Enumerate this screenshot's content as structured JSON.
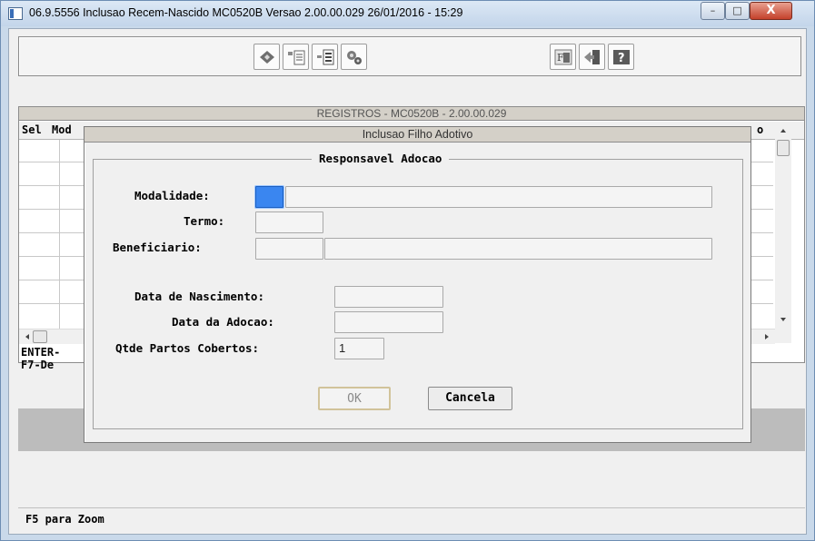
{
  "window": {
    "title": "06.9.5556 Inclusao Recem-Nascido MC0520B Versao 2.00.00.029 26/01/2016 - 15:29",
    "minimize": "–",
    "maximize": "□",
    "close": "X"
  },
  "toolbar": {
    "buttons": [
      "edit-icon",
      "list-icon",
      "insert-icon",
      "config-icon",
      "zoom-icon",
      "exit-icon",
      "help-icon"
    ]
  },
  "registros": {
    "title": "REGISTROS - MC0520B - 2.00.00.029",
    "columns": [
      "Sel",
      "Mod",
      "o"
    ],
    "footer_lines": [
      "ENTER-",
      "F7-De"
    ]
  },
  "dialog": {
    "title": "Inclusao Filho Adotivo",
    "group_title": "Responsavel Adocao",
    "labels": {
      "modalidade": "Modalidade:",
      "termo": "Termo:",
      "beneficiario": "Beneficiario:",
      "data_nascimento": "Data de Nascimento:",
      "data_adocao": "Data da Adocao:",
      "qtde_partos": "Qtde Partos Cobertos:"
    },
    "values": {
      "modalidade_code": "",
      "modalidade_desc": "",
      "termo": "",
      "beneficiario_code": "",
      "beneficiario_name": "",
      "data_nascimento": "",
      "data_adocao": "",
      "qtde_partos": "1"
    },
    "buttons": {
      "ok": "OK",
      "cancel": "Cancela"
    }
  },
  "status_bar": {
    "text": "F5 para Zoom"
  },
  "colors": {
    "focus_field": "#3a86f0",
    "close_button": "#c4412b",
    "gray_band": "#bcbcbc"
  }
}
